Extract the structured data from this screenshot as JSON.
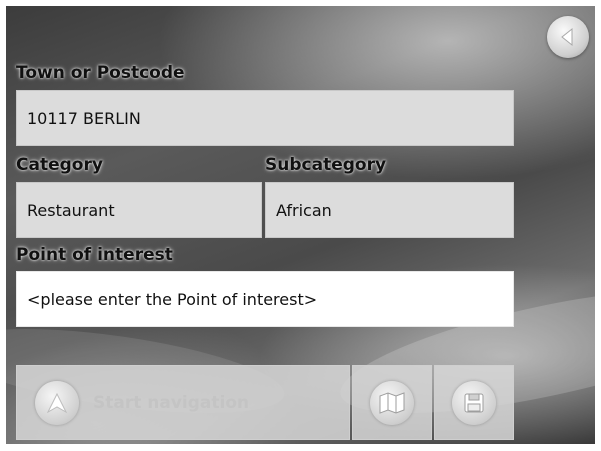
{
  "fields": {
    "town": {
      "label": "Town or Postcode",
      "value": "10117 BERLIN"
    },
    "category": {
      "label": "Category",
      "value": "Restaurant"
    },
    "subcategory": {
      "label": "Subcategory",
      "value": "African"
    },
    "poi": {
      "label": "Point of interest",
      "value": "<please enter the Point of interest>"
    }
  },
  "buttons": {
    "start_navigation": "Start navigation",
    "map_icon": "map-icon",
    "save_icon": "floppy-disk-icon",
    "back_icon": "back-arrow-icon",
    "start_icon": "navigation-arrow-icon"
  }
}
